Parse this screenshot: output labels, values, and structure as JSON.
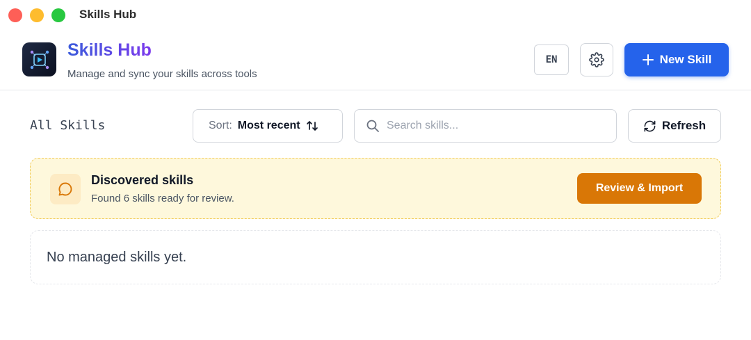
{
  "window": {
    "title": "Skills Hub"
  },
  "header": {
    "brand_title": "Skills Hub",
    "brand_subtitle": "Manage and sync your skills across tools",
    "language_label": "EN",
    "new_skill_label": "New Skill"
  },
  "toolbar": {
    "title": "All Skills",
    "sort_label": "Sort:",
    "sort_value": "Most recent",
    "search_placeholder": "Search skills...",
    "search_value": "",
    "refresh_label": "Refresh"
  },
  "discovered": {
    "title": "Discovered skills",
    "subtitle": "Found 6 skills ready for review.",
    "action_label": "Review & Import"
  },
  "empty_state": {
    "message": "No managed skills yet."
  },
  "colors": {
    "accent": "#2563eb",
    "warning": "#d97706",
    "warning_bg": "#fef8dc"
  },
  "icons": [
    "logo-icon",
    "gear-icon",
    "plus-icon",
    "sort-icon",
    "search-icon",
    "refresh-icon",
    "chat-bubble-icon"
  ]
}
